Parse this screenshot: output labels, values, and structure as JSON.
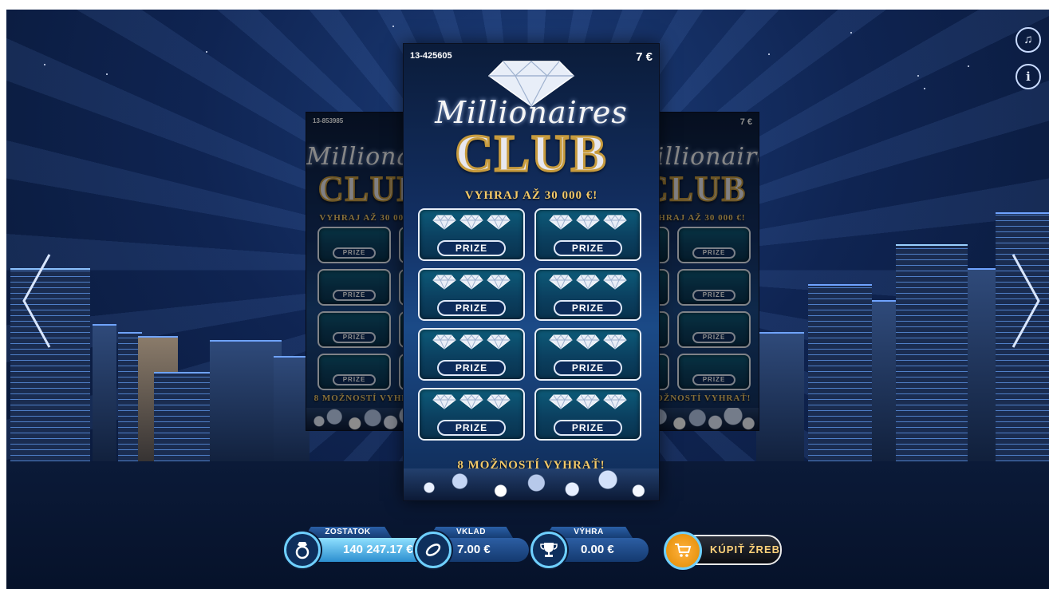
{
  "ticket": {
    "serial": "13-425605",
    "price": "7 €",
    "script_title": "Millionaires",
    "club_title": "CLUB",
    "headline": "VYHRAJ AŽ 30 000 €!",
    "prize_label": "PRIZE",
    "footer": "8 MOŽNOSTÍ VYHRAŤ!"
  },
  "left_ticket": {
    "serial": "13-853985"
  },
  "right_ticket": {
    "price": "7 €"
  },
  "balance": {
    "label": "ZOSTATOK",
    "value": "140 247.17 €"
  },
  "stake": {
    "label": "VKLAD",
    "value": "7.00 €"
  },
  "win": {
    "label": "VÝHRA",
    "value": "0.00 €"
  },
  "buy_button": {
    "label": "KÚPIŤ ŽREB"
  },
  "icons": {
    "music": "music-note-icon",
    "info": "info-icon",
    "prev": "chevron-left-icon",
    "next": "chevron-right-icon",
    "balance": "ring-icon",
    "stake": "coin-icon",
    "win": "trophy-icon",
    "buy": "cart-icon"
  },
  "colors": {
    "accent_gold": "#f3c969",
    "accent_cyan": "#6fd0ff",
    "background": "#0f2452"
  }
}
